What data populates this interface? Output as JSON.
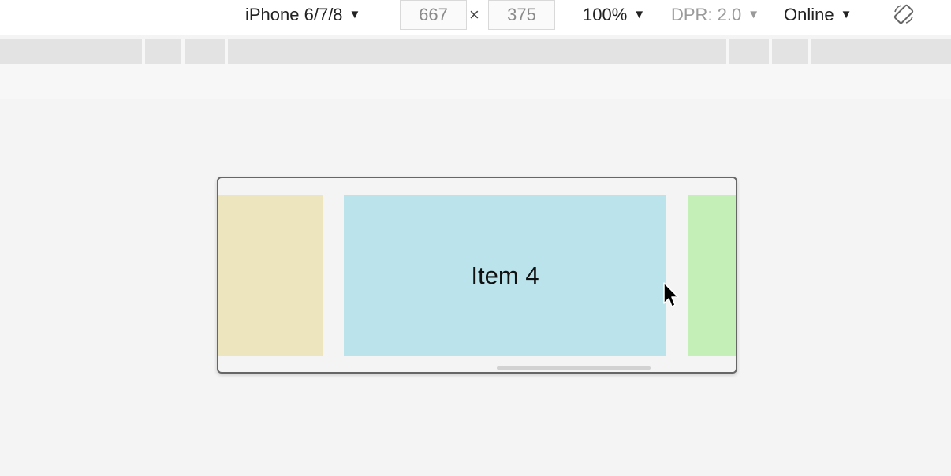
{
  "toolbar": {
    "device": "iPhone 6/7/8",
    "width": "667",
    "times": "×",
    "height": "375",
    "zoom": "100%",
    "dpr": "DPR: 2.0",
    "network": "Online",
    "caret": "▼"
  },
  "carousel": {
    "center_label": "Item 4",
    "colors": {
      "left": "#ede5bd",
      "center": "#bae3eb",
      "right": "#c4f0b8"
    }
  },
  "icons": {
    "rotate": "rotate-icon",
    "cursor": "mouse-pointer-icon"
  }
}
